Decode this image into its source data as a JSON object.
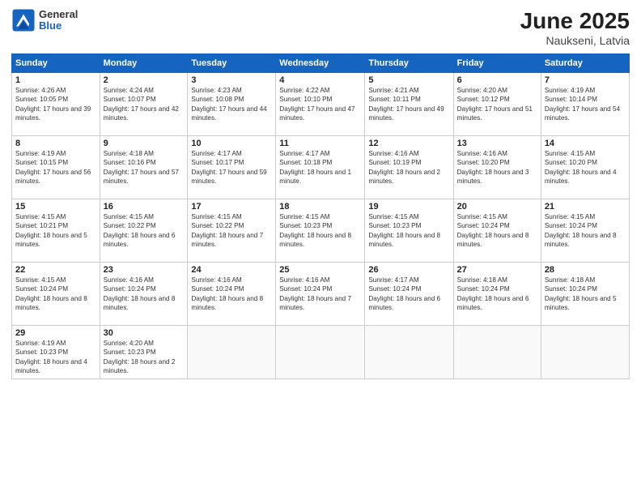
{
  "header": {
    "logo_general": "General",
    "logo_blue": "Blue",
    "month_title": "June 2025",
    "location": "Naukseni, Latvia"
  },
  "weekdays": [
    "Sunday",
    "Monday",
    "Tuesday",
    "Wednesday",
    "Thursday",
    "Friday",
    "Saturday"
  ],
  "weeks": [
    [
      {
        "day": "1",
        "rise": "4:26 AM",
        "set": "10:05 PM",
        "daylight": "17 hours and 39 minutes."
      },
      {
        "day": "2",
        "rise": "4:24 AM",
        "set": "10:07 PM",
        "daylight": "17 hours and 42 minutes."
      },
      {
        "day": "3",
        "rise": "4:23 AM",
        "set": "10:08 PM",
        "daylight": "17 hours and 44 minutes."
      },
      {
        "day": "4",
        "rise": "4:22 AM",
        "set": "10:10 PM",
        "daylight": "17 hours and 47 minutes."
      },
      {
        "day": "5",
        "rise": "4:21 AM",
        "set": "10:11 PM",
        "daylight": "17 hours and 49 minutes."
      },
      {
        "day": "6",
        "rise": "4:20 AM",
        "set": "10:12 PM",
        "daylight": "17 hours and 51 minutes."
      },
      {
        "day": "7",
        "rise": "4:19 AM",
        "set": "10:14 PM",
        "daylight": "17 hours and 54 minutes."
      }
    ],
    [
      {
        "day": "8",
        "rise": "4:19 AM",
        "set": "10:15 PM",
        "daylight": "17 hours and 56 minutes."
      },
      {
        "day": "9",
        "rise": "4:18 AM",
        "set": "10:16 PM",
        "daylight": "17 hours and 57 minutes."
      },
      {
        "day": "10",
        "rise": "4:17 AM",
        "set": "10:17 PM",
        "daylight": "17 hours and 59 minutes."
      },
      {
        "day": "11",
        "rise": "4:17 AM",
        "set": "10:18 PM",
        "daylight": "18 hours and 1 minute."
      },
      {
        "day": "12",
        "rise": "4:16 AM",
        "set": "10:19 PM",
        "daylight": "18 hours and 2 minutes."
      },
      {
        "day": "13",
        "rise": "4:16 AM",
        "set": "10:20 PM",
        "daylight": "18 hours and 3 minutes."
      },
      {
        "day": "14",
        "rise": "4:15 AM",
        "set": "10:20 PM",
        "daylight": "18 hours and 4 minutes."
      }
    ],
    [
      {
        "day": "15",
        "rise": "4:15 AM",
        "set": "10:21 PM",
        "daylight": "18 hours and 5 minutes."
      },
      {
        "day": "16",
        "rise": "4:15 AM",
        "set": "10:22 PM",
        "daylight": "18 hours and 6 minutes."
      },
      {
        "day": "17",
        "rise": "4:15 AM",
        "set": "10:22 PM",
        "daylight": "18 hours and 7 minutes."
      },
      {
        "day": "18",
        "rise": "4:15 AM",
        "set": "10:23 PM",
        "daylight": "18 hours and 8 minutes."
      },
      {
        "day": "19",
        "rise": "4:15 AM",
        "set": "10:23 PM",
        "daylight": "18 hours and 8 minutes."
      },
      {
        "day": "20",
        "rise": "4:15 AM",
        "set": "10:24 PM",
        "daylight": "18 hours and 8 minutes."
      },
      {
        "day": "21",
        "rise": "4:15 AM",
        "set": "10:24 PM",
        "daylight": "18 hours and 8 minutes."
      }
    ],
    [
      {
        "day": "22",
        "rise": "4:15 AM",
        "set": "10:24 PM",
        "daylight": "18 hours and 8 minutes."
      },
      {
        "day": "23",
        "rise": "4:16 AM",
        "set": "10:24 PM",
        "daylight": "18 hours and 8 minutes."
      },
      {
        "day": "24",
        "rise": "4:16 AM",
        "set": "10:24 PM",
        "daylight": "18 hours and 8 minutes."
      },
      {
        "day": "25",
        "rise": "4:16 AM",
        "set": "10:24 PM",
        "daylight": "18 hours and 7 minutes."
      },
      {
        "day": "26",
        "rise": "4:17 AM",
        "set": "10:24 PM",
        "daylight": "18 hours and 6 minutes."
      },
      {
        "day": "27",
        "rise": "4:18 AM",
        "set": "10:24 PM",
        "daylight": "18 hours and 6 minutes."
      },
      {
        "day": "28",
        "rise": "4:18 AM",
        "set": "10:24 PM",
        "daylight": "18 hours and 5 minutes."
      }
    ],
    [
      {
        "day": "29",
        "rise": "4:19 AM",
        "set": "10:23 PM",
        "daylight": "18 hours and 4 minutes."
      },
      {
        "day": "30",
        "rise": "4:20 AM",
        "set": "10:23 PM",
        "daylight": "18 hours and 2 minutes."
      },
      null,
      null,
      null,
      null,
      null
    ]
  ]
}
